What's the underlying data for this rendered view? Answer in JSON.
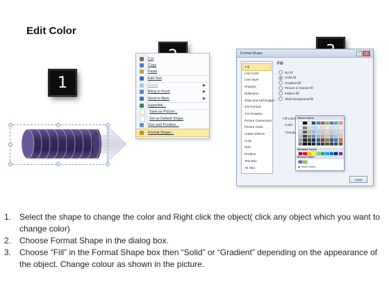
{
  "slide": {
    "title": "Edit Color"
  },
  "badges": [
    "1",
    "2",
    "3"
  ],
  "context_menu": {
    "items": [
      {
        "label": "Cut",
        "icon": "scissors-icon",
        "color": "#6b6b6b",
        "disabled": false,
        "submenu": false
      },
      {
        "label": "Copy",
        "icon": "copy-icon",
        "color": "#5a7cb8",
        "disabled": false,
        "submenu": false
      },
      {
        "label": "Paste",
        "icon": "paste-icon",
        "color": "#c9a24a",
        "disabled": false,
        "submenu": false
      },
      {
        "label": "Edit Text",
        "icon": "edit-text-icon",
        "color": "#3d6fb0",
        "disabled": false,
        "submenu": false
      },
      {
        "label": "Group",
        "icon": "group-icon",
        "color": "#b9c2cf",
        "disabled": true,
        "submenu": true
      },
      {
        "label": "Bring to Front",
        "icon": "bring-to-front-icon",
        "color": "#5a86c4",
        "disabled": false,
        "submenu": true
      },
      {
        "label": "Send to Back",
        "icon": "send-to-back-icon",
        "color": "#4a74b2",
        "disabled": false,
        "submenu": true
      },
      {
        "label": "Hyperlink...",
        "icon": "hyperlink-icon",
        "color": "#3a8a4a",
        "disabled": false,
        "submenu": false
      },
      {
        "label": "Save as Picture...",
        "icon": "save-picture-icon",
        "color": "#ffffff",
        "disabled": false,
        "submenu": false
      },
      {
        "label": "Set as Default Shape",
        "icon": "default-shape-icon",
        "color": "#ffffff",
        "disabled": false,
        "submenu": false
      },
      {
        "label": "Size and Position...",
        "icon": "size-position-icon",
        "color": "#6c8ec2",
        "disabled": false,
        "submenu": false
      },
      {
        "label": "Format Shape...",
        "icon": "format-shape-icon",
        "color": "#d28a2a",
        "disabled": false,
        "submenu": false,
        "highlighted": true
      }
    ]
  },
  "format_dialog": {
    "title": "Format Shape",
    "help": "?",
    "close_x": "x",
    "categories": [
      "Fill",
      "Line Color",
      "Line Style",
      "Shadow",
      "Reflection",
      "Glow and Soft Edges",
      "3-D Format",
      "3-D Rotation",
      "Picture Corrections",
      "Picture Color",
      "Artistic Effects",
      "Crop",
      "Size",
      "Position",
      "Text Box",
      "Alt Text"
    ],
    "active_category": "Fill",
    "fill_heading": "Fill",
    "options": [
      "No fill",
      "Solid fill",
      "Gradient fill",
      "Picture or texture fill",
      "Pattern fill",
      "Slide background fill"
    ],
    "selected_option": "Solid fill",
    "fill_color_label": "Fill Color",
    "color_label": "Color:",
    "transparency_label": "Transpa",
    "close_button": "Close",
    "palette": {
      "theme_header": "Theme Colors",
      "standard_header": "Standard Colors",
      "recent_header": "Recent Colors",
      "more_colors": "More Colors...",
      "theme_top": [
        "#ffffff",
        "#000000",
        "#eeece1",
        "#1f497d",
        "#4f81bd",
        "#c0504d",
        "#9bbb59",
        "#8064a2",
        "#4bacc6",
        "#f79646"
      ],
      "theme_shades": [
        [
          "#f2f2f2",
          "#7f7f7f",
          "#ddd9c3",
          "#c6d9f0",
          "#dbe5f1",
          "#f2dcdb",
          "#ebf1dd",
          "#e5e0ec",
          "#dbeef3",
          "#fdeada"
        ],
        [
          "#d8d8d8",
          "#595959",
          "#c4bd97",
          "#8db3e2",
          "#b8cce4",
          "#e5b9b7",
          "#d7e3bc",
          "#ccc1d9",
          "#b7dde8",
          "#fbd5b5"
        ],
        [
          "#bfbfbf",
          "#3f3f3f",
          "#938953",
          "#548dd4",
          "#95b3d7",
          "#d99694",
          "#c3d69b",
          "#b2a2c7",
          "#92cddc",
          "#fac08f"
        ],
        [
          "#a5a5a5",
          "#262626",
          "#494429",
          "#17365d",
          "#366092",
          "#953734",
          "#76923c",
          "#5f497a",
          "#31859b",
          "#e36c09"
        ],
        [
          "#7f7f7f",
          "#0c0c0c",
          "#1d1b10",
          "#0f243e",
          "#244061",
          "#632423",
          "#4f6128",
          "#3f3151",
          "#205867",
          "#974806"
        ]
      ],
      "standard": [
        "#c00000",
        "#ff0000",
        "#ffc000",
        "#ffff00",
        "#92d050",
        "#00b050",
        "#00b0f0",
        "#0070c0",
        "#002060",
        "#7030a0"
      ],
      "recent": [
        "#4f6fbf",
        "#92d050"
      ]
    }
  },
  "instructions": [
    {
      "num": "1.",
      "text": "Select the shape to change the color and Right click the object( click any object which you want to change color)"
    },
    {
      "num": "2.",
      "text": "Choose Format Shape in the dialog box."
    },
    {
      "num": "3.",
      "text": "Choose “Fill” in the Format Shape box then “Solid” or “Gradient” depending on the appearance of the object. Change colour as shown in the picture."
    }
  ],
  "colors": {
    "badge_bg": "#0d0d0d",
    "arrow_fill": "#d6d9e6",
    "cylinder_purple": "#3f2f63",
    "menu_highlight": "#fce8a8"
  }
}
